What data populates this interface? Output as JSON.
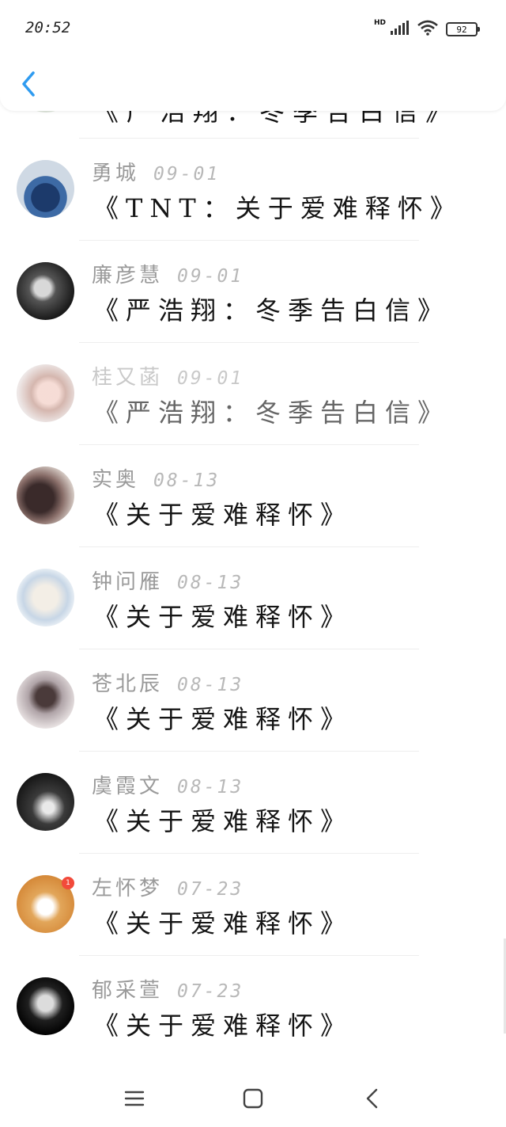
{
  "status_bar": {
    "time": "20:52",
    "network": "HD",
    "battery": "92"
  },
  "peek_row": {
    "title": "《严浩翔：冬季告白信》"
  },
  "rows": [
    {
      "name": "勇城",
      "date": "09-01",
      "title": "《TNT：关于爱难释怀》"
    },
    {
      "name": "廉彦慧",
      "date": "09-01",
      "title": "《严浩翔：冬季告白信》"
    },
    {
      "name": "桂又菡",
      "date": "09-01",
      "title": "《严浩翔：冬季告白信》"
    },
    {
      "name": "实奥",
      "date": "08-13",
      "title": "《关于爱难释怀》"
    },
    {
      "name": "钟问雁",
      "date": "08-13",
      "title": "《关于爱难释怀》"
    },
    {
      "name": "苍北辰",
      "date": "08-13",
      "title": "《关于爱难释怀》"
    },
    {
      "name": "虞霞文",
      "date": "08-13",
      "title": "《关于爱难释怀》"
    },
    {
      "name": "左怀梦",
      "date": "07-23",
      "title": "《关于爱难释怀》",
      "badge": "1"
    },
    {
      "name": "郁采萱",
      "date": "07-23",
      "title": "《关于爱难释怀》"
    }
  ],
  "icons": {
    "back": "back-arrow-icon",
    "signal": "signal-icon",
    "wifi": "wifi-icon",
    "battery": "battery-icon",
    "nav_menu": "menu-icon",
    "nav_home": "home-square-icon",
    "nav_back": "back-triangle-icon"
  },
  "colors": {
    "accent": "#2f9bf0",
    "name": "#9a9a9a",
    "date": "#b8b8b8",
    "badge": "#f24a3a"
  }
}
